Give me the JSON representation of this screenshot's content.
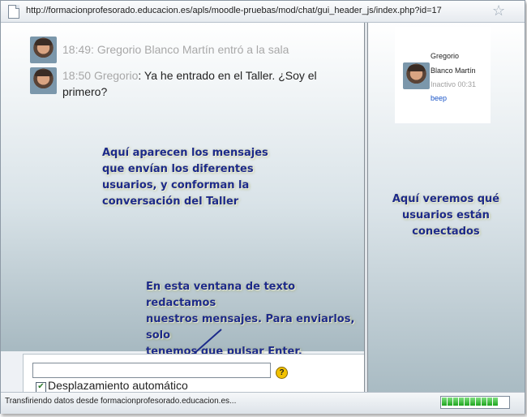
{
  "browser": {
    "url": "http://formacionprofesorado.educacion.es/apls/moodle-pruebas/mod/chat/gui_header_js/index.php?id=17",
    "status_text": "Transfiriendo datos desde formacionprofesorado.educacion.es...",
    "progress_fraction": 1.0
  },
  "messages": [
    {
      "time": "18:49:",
      "author": "",
      "text": "Gregorio Blanco Martín entró a la sala",
      "system": true
    },
    {
      "time": "18:50",
      "author": "Gregorio",
      "text_line1": ": Ya he entrado en el Taller. ¿Soy el",
      "text_line2": "primero?",
      "system": false
    }
  ],
  "annotations": {
    "chat": [
      "Aquí aparecen los mensajes",
      "que envían los diferentes",
      "usuarios, y conforman la",
      "conversación del Taller"
    ],
    "users": [
      "Aquí veremos qué",
      "usuarios están",
      "conectados"
    ],
    "input": [
      "En esta ventana de texto redactamos",
      "nuestros mensajes. Para enviarlos, solo",
      "tenemos que pulsar Enter."
    ]
  },
  "input": {
    "value": "",
    "help_glyph": "?",
    "autoscroll_label": "Desplazamiento automático",
    "autoscroll_checked": true
  },
  "users": [
    {
      "first": "Gregorio",
      "last": "Blanco Martín",
      "idle": "Inactivo 00:31",
      "action": "beep"
    }
  ],
  "colors": {
    "annotation": "#1c2a8a",
    "beep_link": "#1a55c8",
    "system_text": "#a8a8a8",
    "progress": "#1fa51f"
  },
  "icons": {
    "page": "page-icon",
    "favorite": "star-icon",
    "help": "help-icon",
    "check": "checkmark-icon"
  }
}
